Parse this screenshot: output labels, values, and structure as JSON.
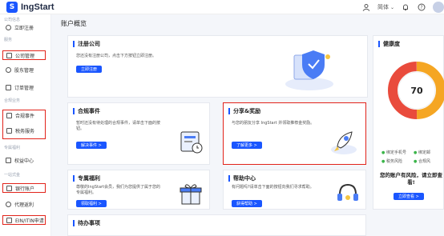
{
  "app": {
    "name": "IngStart",
    "logo_letter": "S"
  },
  "topbar": {
    "language": "简体",
    "language_caret": "⌄",
    "bell_glyph": "♫",
    "help_glyph": "?"
  },
  "sidebar": {
    "sections": [
      {
        "label": "公司信息"
      },
      {
        "label": "服务"
      },
      {
        "label": "合规业务"
      },
      {
        "label": "专属福利"
      },
      {
        "label": "一站式金"
      }
    ],
    "items": [
      {
        "label": "立即注册"
      },
      {
        "label": "公司管理"
      },
      {
        "label": "股东管理"
      },
      {
        "label": "订单管理"
      },
      {
        "label": "合规事件"
      },
      {
        "label": "税务服务"
      },
      {
        "label": "权益中心"
      },
      {
        "label": "银行账户"
      },
      {
        "label": "代理返利"
      },
      {
        "label": "EIN/ITIN申请"
      }
    ]
  },
  "main": {
    "title": "账户概览",
    "register": {
      "title": "注册公司",
      "desc": "您还没有注册公司，点击下方按钮立即注册。",
      "button": "立即注册"
    },
    "compliance": {
      "title": "合规事件",
      "desc": "暂时还没有待处理的合规事件，请单击下面的按钮。",
      "button": "解决事件 >"
    },
    "share": {
      "title": "分享&奖励",
      "desc": "与您的朋友分享 IngStart 并领取推荐金奖励。",
      "button": "了解更多 >"
    },
    "benefits": {
      "title": "专属福利",
      "desc": "尊敬的IngStart会员，我们为您提供了属于您的专属福利。",
      "button": "领取福利 >"
    },
    "help": {
      "title": "帮助中心",
      "desc": "有问题吗?请单击下面的按钮向我们寻求帮助。",
      "button": "获得帮助 >"
    },
    "todo": {
      "title": "待办事项"
    },
    "health": {
      "title": "健康度",
      "score": "70",
      "legend": [
        "绑定手机号",
        "绑定邮",
        "税务风险",
        "合规风"
      ],
      "risk_text": "您的账户有风险，请立即查看!",
      "button": "立即查看 >"
    }
  },
  "colors": {
    "accent": "#1a56ff",
    "highlight": "#e2231a"
  }
}
